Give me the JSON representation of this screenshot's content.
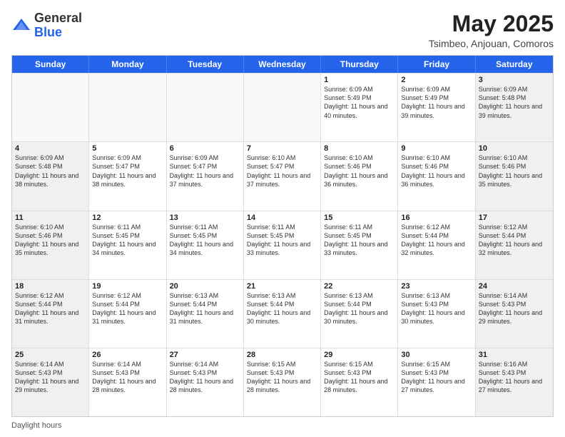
{
  "header": {
    "logo_general": "General",
    "logo_blue": "Blue",
    "month": "May 2025",
    "location": "Tsimbeo, Anjouan, Comoros"
  },
  "weekdays": [
    "Sunday",
    "Monday",
    "Tuesday",
    "Wednesday",
    "Thursday",
    "Friday",
    "Saturday"
  ],
  "footer": "Daylight hours",
  "rows": [
    [
      {
        "day": "",
        "text": "",
        "empty": true
      },
      {
        "day": "",
        "text": "",
        "empty": true
      },
      {
        "day": "",
        "text": "",
        "empty": true
      },
      {
        "day": "",
        "text": "",
        "empty": true
      },
      {
        "day": "1",
        "text": "Sunrise: 6:09 AM\nSunset: 5:49 PM\nDaylight: 11 hours and 40 minutes."
      },
      {
        "day": "2",
        "text": "Sunrise: 6:09 AM\nSunset: 5:49 PM\nDaylight: 11 hours and 39 minutes."
      },
      {
        "day": "3",
        "text": "Sunrise: 6:09 AM\nSunset: 5:48 PM\nDaylight: 11 hours and 39 minutes."
      }
    ],
    [
      {
        "day": "4",
        "text": "Sunrise: 6:09 AM\nSunset: 5:48 PM\nDaylight: 11 hours and 38 minutes."
      },
      {
        "day": "5",
        "text": "Sunrise: 6:09 AM\nSunset: 5:47 PM\nDaylight: 11 hours and 38 minutes."
      },
      {
        "day": "6",
        "text": "Sunrise: 6:09 AM\nSunset: 5:47 PM\nDaylight: 11 hours and 37 minutes."
      },
      {
        "day": "7",
        "text": "Sunrise: 6:10 AM\nSunset: 5:47 PM\nDaylight: 11 hours and 37 minutes."
      },
      {
        "day": "8",
        "text": "Sunrise: 6:10 AM\nSunset: 5:46 PM\nDaylight: 11 hours and 36 minutes."
      },
      {
        "day": "9",
        "text": "Sunrise: 6:10 AM\nSunset: 5:46 PM\nDaylight: 11 hours and 36 minutes."
      },
      {
        "day": "10",
        "text": "Sunrise: 6:10 AM\nSunset: 5:46 PM\nDaylight: 11 hours and 35 minutes."
      }
    ],
    [
      {
        "day": "11",
        "text": "Sunrise: 6:10 AM\nSunset: 5:46 PM\nDaylight: 11 hours and 35 minutes."
      },
      {
        "day": "12",
        "text": "Sunrise: 6:11 AM\nSunset: 5:45 PM\nDaylight: 11 hours and 34 minutes."
      },
      {
        "day": "13",
        "text": "Sunrise: 6:11 AM\nSunset: 5:45 PM\nDaylight: 11 hours and 34 minutes."
      },
      {
        "day": "14",
        "text": "Sunrise: 6:11 AM\nSunset: 5:45 PM\nDaylight: 11 hours and 33 minutes."
      },
      {
        "day": "15",
        "text": "Sunrise: 6:11 AM\nSunset: 5:45 PM\nDaylight: 11 hours and 33 minutes."
      },
      {
        "day": "16",
        "text": "Sunrise: 6:12 AM\nSunset: 5:44 PM\nDaylight: 11 hours and 32 minutes."
      },
      {
        "day": "17",
        "text": "Sunrise: 6:12 AM\nSunset: 5:44 PM\nDaylight: 11 hours and 32 minutes."
      }
    ],
    [
      {
        "day": "18",
        "text": "Sunrise: 6:12 AM\nSunset: 5:44 PM\nDaylight: 11 hours and 31 minutes."
      },
      {
        "day": "19",
        "text": "Sunrise: 6:12 AM\nSunset: 5:44 PM\nDaylight: 11 hours and 31 minutes."
      },
      {
        "day": "20",
        "text": "Sunrise: 6:13 AM\nSunset: 5:44 PM\nDaylight: 11 hours and 31 minutes."
      },
      {
        "day": "21",
        "text": "Sunrise: 6:13 AM\nSunset: 5:44 PM\nDaylight: 11 hours and 30 minutes."
      },
      {
        "day": "22",
        "text": "Sunrise: 6:13 AM\nSunset: 5:44 PM\nDaylight: 11 hours and 30 minutes."
      },
      {
        "day": "23",
        "text": "Sunrise: 6:13 AM\nSunset: 5:43 PM\nDaylight: 11 hours and 30 minutes."
      },
      {
        "day": "24",
        "text": "Sunrise: 6:14 AM\nSunset: 5:43 PM\nDaylight: 11 hours and 29 minutes."
      }
    ],
    [
      {
        "day": "25",
        "text": "Sunrise: 6:14 AM\nSunset: 5:43 PM\nDaylight: 11 hours and 29 minutes."
      },
      {
        "day": "26",
        "text": "Sunrise: 6:14 AM\nSunset: 5:43 PM\nDaylight: 11 hours and 28 minutes."
      },
      {
        "day": "27",
        "text": "Sunrise: 6:14 AM\nSunset: 5:43 PM\nDaylight: 11 hours and 28 minutes."
      },
      {
        "day": "28",
        "text": "Sunrise: 6:15 AM\nSunset: 5:43 PM\nDaylight: 11 hours and 28 minutes."
      },
      {
        "day": "29",
        "text": "Sunrise: 6:15 AM\nSunset: 5:43 PM\nDaylight: 11 hours and 28 minutes."
      },
      {
        "day": "30",
        "text": "Sunrise: 6:15 AM\nSunset: 5:43 PM\nDaylight: 11 hours and 27 minutes."
      },
      {
        "day": "31",
        "text": "Sunrise: 6:16 AM\nSunset: 5:43 PM\nDaylight: 11 hours and 27 minutes."
      }
    ]
  ]
}
